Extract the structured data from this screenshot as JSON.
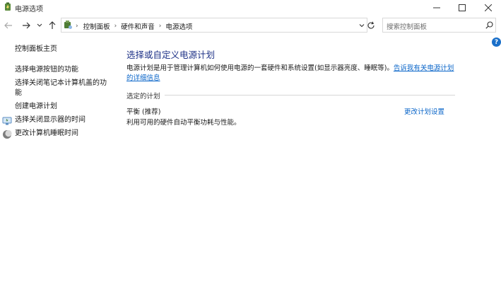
{
  "window": {
    "title": "电源选项",
    "icons": {
      "app": "power-options-icon",
      "minimize": "minimize-icon",
      "maximize": "maximize-icon",
      "close": "close-icon"
    }
  },
  "nav": {
    "icons": [
      "back-arrow-icon",
      "forward-arrow-icon",
      "recent-dropdown-icon",
      "up-arrow-icon",
      "refresh-icon"
    ],
    "breadcrumbs": [
      "控制面板",
      "硬件和声音",
      "电源选项"
    ],
    "search": {
      "placeholder": "搜索控制面板"
    }
  },
  "sidebar": {
    "items": [
      {
        "label": "控制面板主页"
      },
      {
        "label": "选择电源按钮的功能"
      },
      {
        "label": "选择关闭笔记本计算机盖的功",
        "label_line2": "能"
      },
      {
        "label": "创建电源计划"
      },
      {
        "label": "选择关闭显示器的时间",
        "icon": "display-power-icon"
      },
      {
        "label": "更改计算机睡眠时间",
        "icon": "moon-sleep-icon"
      }
    ]
  },
  "main": {
    "title": "选择或自定义电源计划",
    "description": "电源计划是用于管理计算机如何使用电源的一套硬件和系统设置(如显示器亮度、睡眠等)。",
    "description_link": "告诉我有关电源计划的详细信息",
    "section_label": "选定的计划",
    "plan": {
      "name": "平衡 (推荐)",
      "description": "利用可用的硬件自动平衡功耗与性能。",
      "change_link": "更改计划设置"
    }
  },
  "colors": {
    "accent": "#1e3287",
    "link": "#0b66c9",
    "help": "#1a6fc9"
  }
}
